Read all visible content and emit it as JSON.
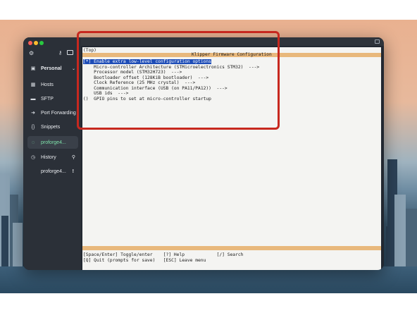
{
  "sidebar": {
    "vault_label": "Personal",
    "items": [
      {
        "label": "Hosts",
        "icon": "server-icon"
      },
      {
        "label": "SFTP",
        "icon": "folder-icon"
      },
      {
        "label": "Port Forwarding",
        "icon": "arrow-icon"
      },
      {
        "label": "Snippets",
        "icon": "braces-icon"
      },
      {
        "label": "proforge4...",
        "icon": "terminal-icon"
      }
    ],
    "history_label": "History",
    "history_items": [
      {
        "label": "proforge4...",
        "badge": "!"
      }
    ]
  },
  "terminal": {
    "breadcrumb": "(Top)",
    "title": "Klipper Firmware Configuration",
    "options": [
      {
        "prefix": "[*] ",
        "text": "Enable extra low-level configuration options",
        "selected": true
      },
      {
        "prefix": "    ",
        "text": "Micro-controller Architecture (STMicroelectronics STM32)  --->"
      },
      {
        "prefix": "    ",
        "text": "Processor model (STM32H723)  --->"
      },
      {
        "prefix": "    ",
        "text": "Bootloader offset (128KiB bootloader)  --->"
      },
      {
        "prefix": "    ",
        "text": "Clock Reference (25 MHz crystal)  --->"
      },
      {
        "prefix": "    ",
        "text": "Communication interface (USB (on PA11/PA12))  --->"
      },
      {
        "prefix": "    ",
        "text": "USB ids  --->"
      },
      {
        "prefix": "()  ",
        "text": "GPIO pins to set at micro-controller startup"
      }
    ],
    "footer": {
      "line1": "[Space/Enter] Toggle/enter    [?] Help            [/] Search",
      "line2": "[Q] Quit (prompts for save)   [ESC] Leave menu"
    }
  },
  "colors": {
    "highlight_box": "#c7281f",
    "active_green": "#7ee0a9",
    "menu_band": "#e8b87c"
  }
}
